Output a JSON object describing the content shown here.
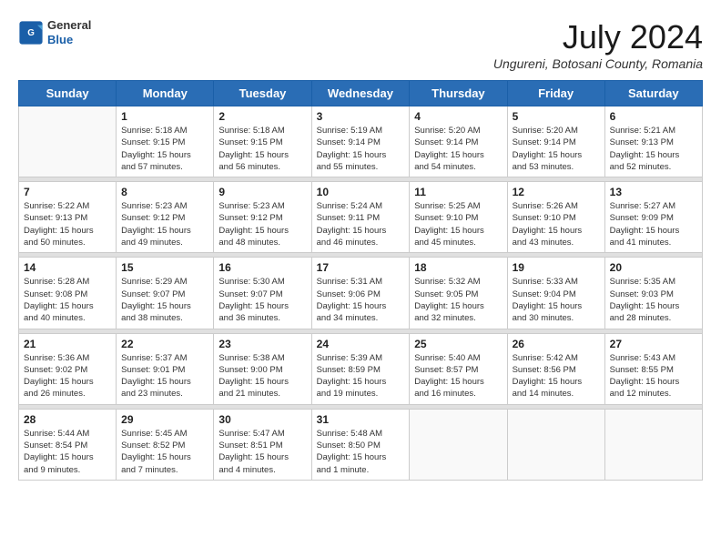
{
  "header": {
    "logo_general": "General",
    "logo_blue": "Blue",
    "title": "July 2024",
    "subtitle": "Ungureni, Botosani County, Romania"
  },
  "weekdays": [
    "Sunday",
    "Monday",
    "Tuesday",
    "Wednesday",
    "Thursday",
    "Friday",
    "Saturday"
  ],
  "weeks": [
    [
      {
        "day": "",
        "info": ""
      },
      {
        "day": "1",
        "info": "Sunrise: 5:18 AM\nSunset: 9:15 PM\nDaylight: 15 hours\nand 57 minutes."
      },
      {
        "day": "2",
        "info": "Sunrise: 5:18 AM\nSunset: 9:15 PM\nDaylight: 15 hours\nand 56 minutes."
      },
      {
        "day": "3",
        "info": "Sunrise: 5:19 AM\nSunset: 9:14 PM\nDaylight: 15 hours\nand 55 minutes."
      },
      {
        "day": "4",
        "info": "Sunrise: 5:20 AM\nSunset: 9:14 PM\nDaylight: 15 hours\nand 54 minutes."
      },
      {
        "day": "5",
        "info": "Sunrise: 5:20 AM\nSunset: 9:14 PM\nDaylight: 15 hours\nand 53 minutes."
      },
      {
        "day": "6",
        "info": "Sunrise: 5:21 AM\nSunset: 9:13 PM\nDaylight: 15 hours\nand 52 minutes."
      }
    ],
    [
      {
        "day": "7",
        "info": "Sunrise: 5:22 AM\nSunset: 9:13 PM\nDaylight: 15 hours\nand 50 minutes."
      },
      {
        "day": "8",
        "info": "Sunrise: 5:23 AM\nSunset: 9:12 PM\nDaylight: 15 hours\nand 49 minutes."
      },
      {
        "day": "9",
        "info": "Sunrise: 5:23 AM\nSunset: 9:12 PM\nDaylight: 15 hours\nand 48 minutes."
      },
      {
        "day": "10",
        "info": "Sunrise: 5:24 AM\nSunset: 9:11 PM\nDaylight: 15 hours\nand 46 minutes."
      },
      {
        "day": "11",
        "info": "Sunrise: 5:25 AM\nSunset: 9:10 PM\nDaylight: 15 hours\nand 45 minutes."
      },
      {
        "day": "12",
        "info": "Sunrise: 5:26 AM\nSunset: 9:10 PM\nDaylight: 15 hours\nand 43 minutes."
      },
      {
        "day": "13",
        "info": "Sunrise: 5:27 AM\nSunset: 9:09 PM\nDaylight: 15 hours\nand 41 minutes."
      }
    ],
    [
      {
        "day": "14",
        "info": "Sunrise: 5:28 AM\nSunset: 9:08 PM\nDaylight: 15 hours\nand 40 minutes."
      },
      {
        "day": "15",
        "info": "Sunrise: 5:29 AM\nSunset: 9:07 PM\nDaylight: 15 hours\nand 38 minutes."
      },
      {
        "day": "16",
        "info": "Sunrise: 5:30 AM\nSunset: 9:07 PM\nDaylight: 15 hours\nand 36 minutes."
      },
      {
        "day": "17",
        "info": "Sunrise: 5:31 AM\nSunset: 9:06 PM\nDaylight: 15 hours\nand 34 minutes."
      },
      {
        "day": "18",
        "info": "Sunrise: 5:32 AM\nSunset: 9:05 PM\nDaylight: 15 hours\nand 32 minutes."
      },
      {
        "day": "19",
        "info": "Sunrise: 5:33 AM\nSunset: 9:04 PM\nDaylight: 15 hours\nand 30 minutes."
      },
      {
        "day": "20",
        "info": "Sunrise: 5:35 AM\nSunset: 9:03 PM\nDaylight: 15 hours\nand 28 minutes."
      }
    ],
    [
      {
        "day": "21",
        "info": "Sunrise: 5:36 AM\nSunset: 9:02 PM\nDaylight: 15 hours\nand 26 minutes."
      },
      {
        "day": "22",
        "info": "Sunrise: 5:37 AM\nSunset: 9:01 PM\nDaylight: 15 hours\nand 23 minutes."
      },
      {
        "day": "23",
        "info": "Sunrise: 5:38 AM\nSunset: 9:00 PM\nDaylight: 15 hours\nand 21 minutes."
      },
      {
        "day": "24",
        "info": "Sunrise: 5:39 AM\nSunset: 8:59 PM\nDaylight: 15 hours\nand 19 minutes."
      },
      {
        "day": "25",
        "info": "Sunrise: 5:40 AM\nSunset: 8:57 PM\nDaylight: 15 hours\nand 16 minutes."
      },
      {
        "day": "26",
        "info": "Sunrise: 5:42 AM\nSunset: 8:56 PM\nDaylight: 15 hours\nand 14 minutes."
      },
      {
        "day": "27",
        "info": "Sunrise: 5:43 AM\nSunset: 8:55 PM\nDaylight: 15 hours\nand 12 minutes."
      }
    ],
    [
      {
        "day": "28",
        "info": "Sunrise: 5:44 AM\nSunset: 8:54 PM\nDaylight: 15 hours\nand 9 minutes."
      },
      {
        "day": "29",
        "info": "Sunrise: 5:45 AM\nSunset: 8:52 PM\nDaylight: 15 hours\nand 7 minutes."
      },
      {
        "day": "30",
        "info": "Sunrise: 5:47 AM\nSunset: 8:51 PM\nDaylight: 15 hours\nand 4 minutes."
      },
      {
        "day": "31",
        "info": "Sunrise: 5:48 AM\nSunset: 8:50 PM\nDaylight: 15 hours\nand 1 minute."
      },
      {
        "day": "",
        "info": ""
      },
      {
        "day": "",
        "info": ""
      },
      {
        "day": "",
        "info": ""
      }
    ]
  ]
}
